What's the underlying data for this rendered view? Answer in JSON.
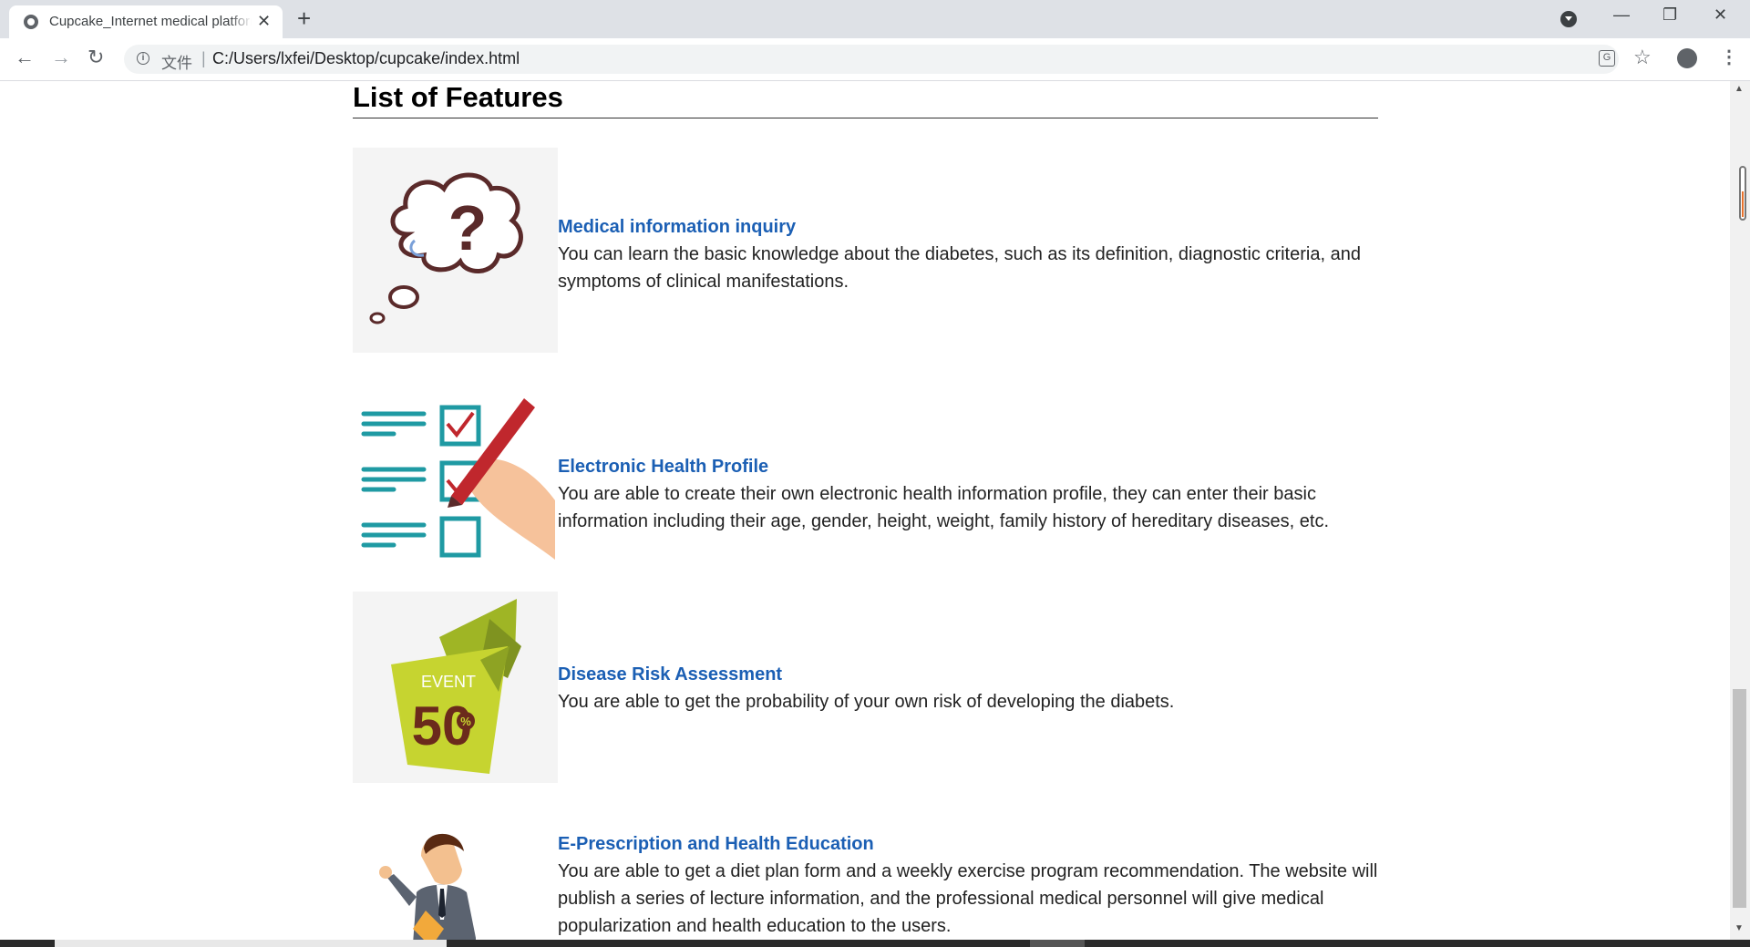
{
  "browser": {
    "tab_title": "Cupcake_Internet medical platform",
    "tab_close": "✕",
    "new_tab": "+",
    "address_label": "文件",
    "address_sep": "|",
    "url": "C:/Users/lxfei/Desktop/cupcake/index.html",
    "back": "←",
    "forward": "→",
    "reload": "↻",
    "info": "i",
    "minimize": "—",
    "restore": "❐",
    "close_window": "✕",
    "translate": "G",
    "bookmark": "☆",
    "menu": "⋮"
  },
  "page": {
    "section_title": "List of Features",
    "features": [
      {
        "heading": "Medical information inquiry",
        "description": "You can learn the basic knowledge about the diabetes, such as its definition, diagnostic criteria, and symptoms of clinical manifestations.",
        "icon": "thought-bubble-question-icon"
      },
      {
        "heading": "Electronic Health Profile",
        "description": "You are able to create their own electronic health information profile, they can enter their basic information including their age, gender, height, weight, family history of hereditary diseases, etc.",
        "icon": "checklist-pen-icon"
      },
      {
        "heading": "Disease Risk Assessment",
        "description": "You are able to get the probability of your own risk of developing the diabets.",
        "icon": "event-50-percent-icon",
        "badge_text": "EVENT",
        "badge_number": "50",
        "badge_percent": "%"
      },
      {
        "heading": "E-Prescription and Health Education",
        "description": "You are able to get a diet plan form and a weekly exercise program recommendation. The website will publish a series of lecture information, and the professional medical personnel will give medical popularization and health education to the users.",
        "icon": "doctor-presenter-icon"
      }
    ]
  },
  "colors": {
    "link_blue": "#1b5fb4",
    "chrome_bg": "#dee1e6",
    "teal": "#1f9aa3",
    "lime": "#b6c92a"
  }
}
